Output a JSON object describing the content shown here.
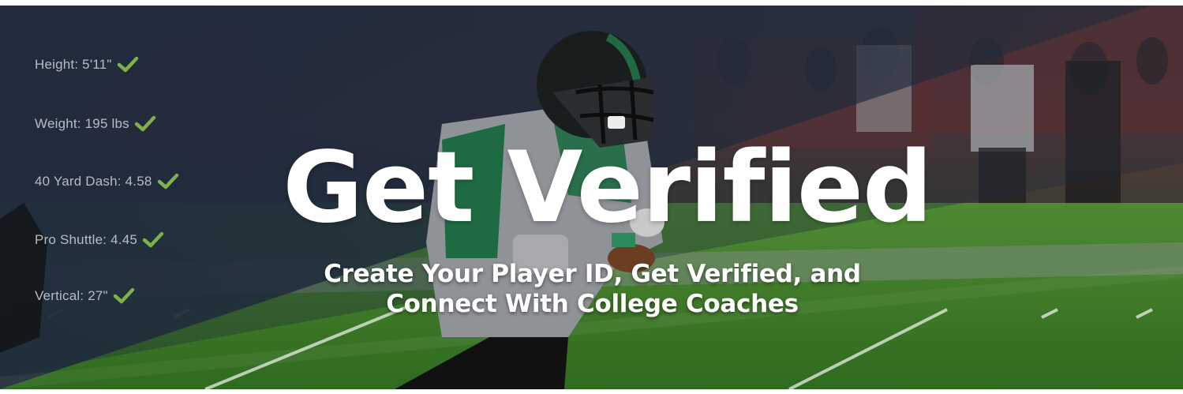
{
  "banner": {
    "title": "Get Verified",
    "subtitle_line1": "Create Your Player ID, Get Verified, and",
    "subtitle_line2": "Connect With College Coaches"
  },
  "stats": [
    {
      "label": "Height: 5'11\""
    },
    {
      "label": "Weight: 195 lbs"
    },
    {
      "label": "40 Yard Dash: 4.58"
    },
    {
      "label": "Pro Shuttle: 4.45"
    },
    {
      "label": "Vertical: 27\""
    }
  ],
  "colors": {
    "overlay": "#1f2a3d",
    "check": "#7fb04a",
    "turf": "#3f7a2a",
    "jersey_green": "#1e6b43",
    "text": "#ffffff"
  },
  "icons": {
    "stat_check": "checkmark-icon"
  }
}
